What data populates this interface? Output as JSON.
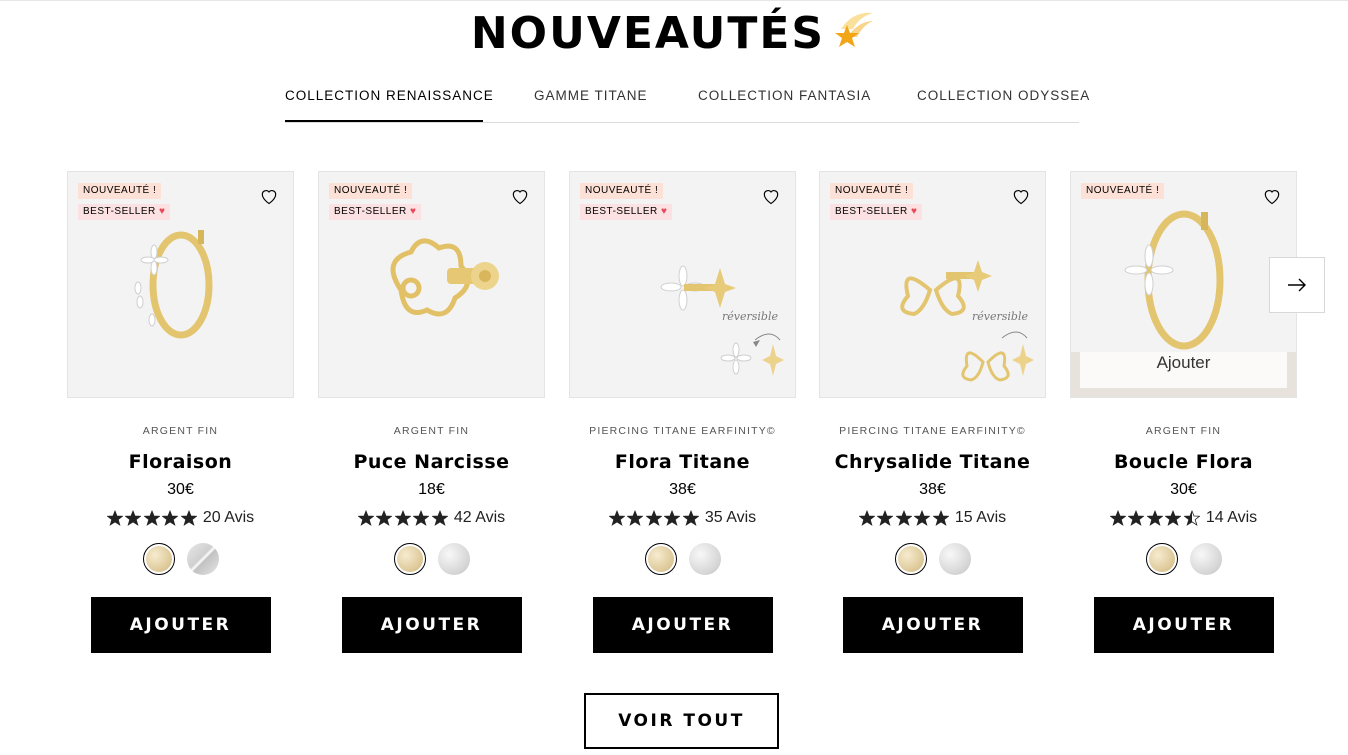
{
  "section": {
    "title": "NOUVEAUTÉS",
    "title_emoji": "shooting-star-emoji"
  },
  "tabs": [
    {
      "label": "COLLECTION RENAISSANCE",
      "active": true
    },
    {
      "label": "GAMME TITANE",
      "active": false
    },
    {
      "label": "COLLECTION FANTASIA",
      "active": false
    },
    {
      "label": "COLLECTION ODYSSEA",
      "active": false
    }
  ],
  "products": [
    {
      "badge_new": "NOUVEAUTÉ !",
      "badge_best": "BEST-SELLER",
      "material": "ARGENT FIN",
      "name": "Floraison",
      "price": "30€",
      "rating": 5,
      "reviews": "20 Avis",
      "swatches": [
        "gold",
        "silver-split"
      ],
      "add_label": "AJOUTER"
    },
    {
      "badge_new": "NOUVEAUTÉ !",
      "badge_best": "BEST-SELLER",
      "material": "ARGENT FIN",
      "name": "Puce Narcisse",
      "price": "18€",
      "rating": 5,
      "reviews": "42 Avis",
      "swatches": [
        "gold",
        "silver"
      ],
      "add_label": "AJOUTER"
    },
    {
      "badge_new": "NOUVEAUTÉ !",
      "badge_best": "BEST-SELLER",
      "material": "PIERCING TITANE EARFINITY©",
      "name": "Flora Titane",
      "price": "38€",
      "rating": 5,
      "reviews": "35 Avis",
      "swatches": [
        "gold",
        "silver"
      ],
      "image_note": "réversible",
      "add_label": "AJOUTER"
    },
    {
      "badge_new": "NOUVEAUTÉ !",
      "badge_best": "BEST-SELLER",
      "material": "PIERCING TITANE EARFINITY©",
      "name": "Chrysalide Titane",
      "price": "38€",
      "rating": 5,
      "reviews": "15 Avis",
      "swatches": [
        "gold",
        "silver"
      ],
      "image_note": "réversible",
      "add_label": "AJOUTER"
    },
    {
      "badge_new": "NOUVEAUTÉ !",
      "material": "ARGENT FIN",
      "name": "Boucle Flora",
      "price": "30€",
      "rating": 4.5,
      "reviews": "14 Avis",
      "swatches": [
        "gold",
        "silver"
      ],
      "hover_add_label": "Ajouter",
      "add_label": "AJOUTER"
    }
  ],
  "voir_tout": "VOIR TOUT",
  "colors": {
    "gold": "#e2c16b",
    "badge_new_bg": "#fde0d6",
    "black": "#000000"
  }
}
